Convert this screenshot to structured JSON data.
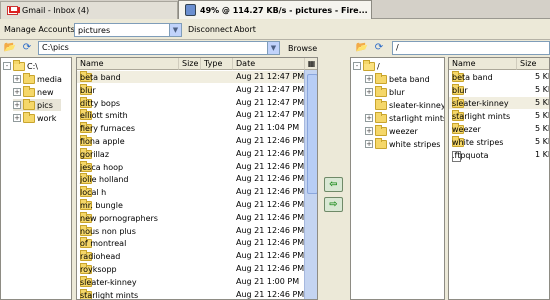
{
  "tabs": [
    {
      "label": "Gmail - Inbox (4)",
      "icon": "gmail-icon"
    },
    {
      "label": "49% @ 114.27 KB/s - pictures - Fire...",
      "icon": "fireftp-icon"
    }
  ],
  "toolbar": {
    "manage_label": "Manage Accounts",
    "account_value": "pictures",
    "disconnect_label": "Disconnect",
    "abort_label": "Abort"
  },
  "local": {
    "path": "C:\\pics",
    "browse_label": "Browse",
    "tree": [
      {
        "label": "C:\\",
        "expander": "-"
      },
      {
        "label": "media",
        "expander": "+"
      },
      {
        "label": "new",
        "expander": "+"
      },
      {
        "label": "pics",
        "expander": "+"
      },
      {
        "label": "work",
        "expander": "+"
      }
    ],
    "columns": {
      "name": "Name",
      "size": "Size",
      "type": "Type",
      "date": "Date"
    },
    "files": [
      {
        "name": "beta band",
        "date": "Aug 21 12:47 PM"
      },
      {
        "name": "blur",
        "date": "Aug 21 12:47 PM"
      },
      {
        "name": "ditty bops",
        "date": "Aug 21 12:47 PM"
      },
      {
        "name": "elliott smith",
        "date": "Aug 21 12:47 PM"
      },
      {
        "name": "fiery furnaces",
        "date": "Aug 21 1:04 PM"
      },
      {
        "name": "fiona apple",
        "date": "Aug 21 12:46 PM"
      },
      {
        "name": "gorillaz",
        "date": "Aug 21 12:46 PM"
      },
      {
        "name": "jesca hoop",
        "date": "Aug 21 12:46 PM"
      },
      {
        "name": "jolie holland",
        "date": "Aug 21 12:46 PM"
      },
      {
        "name": "local h",
        "date": "Aug 21 12:46 PM"
      },
      {
        "name": "mr. bungle",
        "date": "Aug 21 12:46 PM"
      },
      {
        "name": "new pornographers",
        "date": "Aug 21 12:46 PM"
      },
      {
        "name": "nous non plus",
        "date": "Aug 21 12:46 PM"
      },
      {
        "name": "of montreal",
        "date": "Aug 21 12:46 PM"
      },
      {
        "name": "radiohead",
        "date": "Aug 21 12:46 PM"
      },
      {
        "name": "royksopp",
        "date": "Aug 21 12:46 PM"
      },
      {
        "name": "sleater-kinney",
        "date": "Aug 21 1:00 PM"
      },
      {
        "name": "starlight mints",
        "date": "Aug 21 12:46 PM"
      }
    ]
  },
  "remote": {
    "path": "/",
    "tree": [
      {
        "label": "/",
        "expander": "-"
      },
      {
        "label": "beta band",
        "expander": "+"
      },
      {
        "label": "blur",
        "expander": "+"
      },
      {
        "label": "sleater-kinney",
        "expander": ""
      },
      {
        "label": "starlight mints",
        "expander": "+"
      },
      {
        "label": "weezer",
        "expander": "+"
      },
      {
        "label": "white stripes",
        "expander": "+"
      }
    ],
    "columns": {
      "name": "Name",
      "size": "Size"
    },
    "files": [
      {
        "name": "beta band",
        "size": "5 KB",
        "kind": "folder"
      },
      {
        "name": "blur",
        "size": "5 KB",
        "kind": "folder"
      },
      {
        "name": "sleater-kinney",
        "size": "5 KB",
        "kind": "folder"
      },
      {
        "name": "starlight mints",
        "size": "5 KB",
        "kind": "folder"
      },
      {
        "name": "weezer",
        "size": "5 KB",
        "kind": "folder"
      },
      {
        "name": "white stripes",
        "size": "5 KB",
        "kind": "folder"
      },
      {
        "name": ".ftpquota",
        "size": "1 KB",
        "kind": "file"
      }
    ]
  }
}
